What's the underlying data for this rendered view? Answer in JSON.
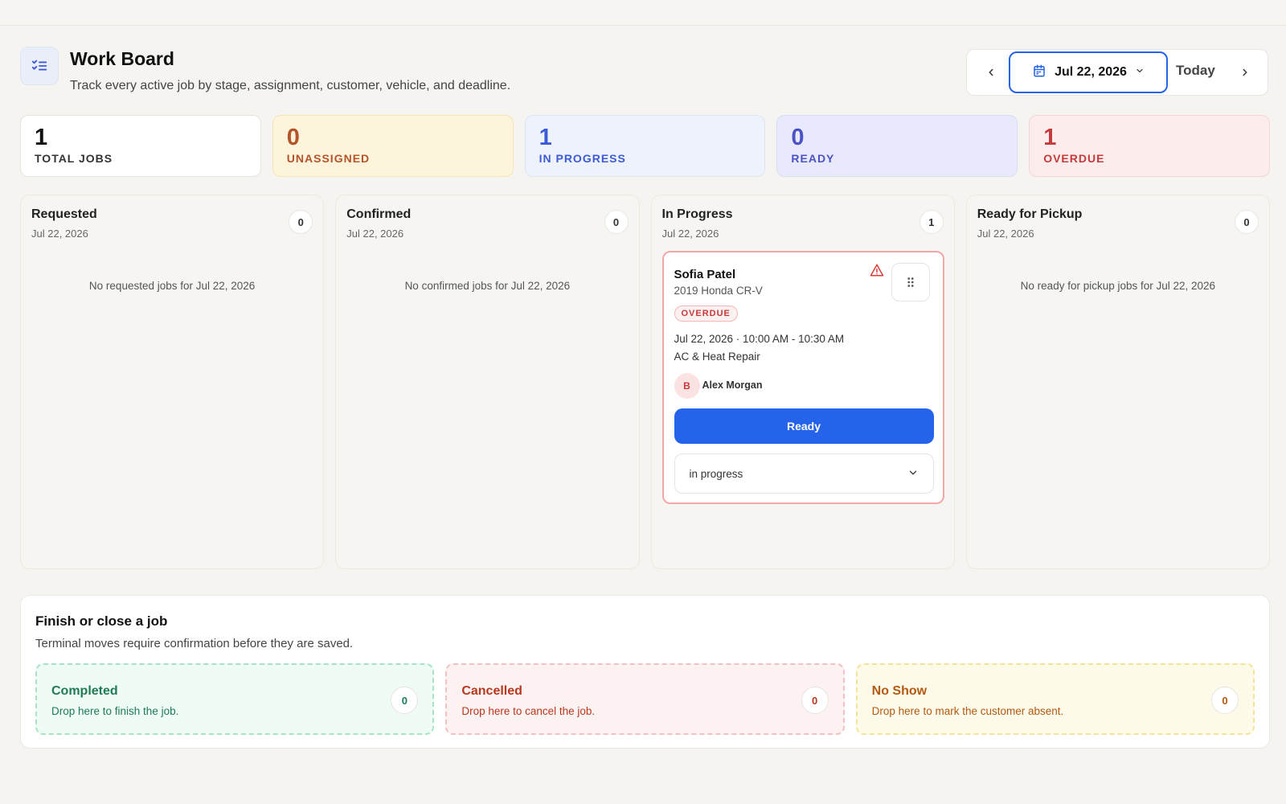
{
  "header": {
    "title": "Work Board",
    "subtitle": "Track every active job by stage, assignment, customer, vehicle, and deadline."
  },
  "datebar": {
    "date_label": "Jul 22, 2026",
    "today_label": "Today"
  },
  "stats": [
    {
      "value": "1",
      "label": "TOTAL JOBS"
    },
    {
      "value": "0",
      "label": "UNASSIGNED"
    },
    {
      "value": "1",
      "label": "IN PROGRESS"
    },
    {
      "value": "0",
      "label": "READY"
    },
    {
      "value": "1",
      "label": "OVERDUE"
    }
  ],
  "columns": [
    {
      "title": "Requested",
      "date": "Jul 22, 2026",
      "count": "0",
      "empty": "No requested jobs for Jul 22, 2026"
    },
    {
      "title": "Confirmed",
      "date": "Jul 22, 2026",
      "count": "0",
      "empty": "No confirmed jobs for Jul 22, 2026"
    },
    {
      "title": "In Progress",
      "date": "Jul 22, 2026",
      "count": "1",
      "empty": ""
    },
    {
      "title": "Ready for Pickup",
      "date": "Jul 22, 2026",
      "count": "0",
      "empty": "No ready for pickup jobs for Jul 22, 2026"
    }
  ],
  "job": {
    "customer": "Sofia Patel",
    "vehicle": "2019 Honda CR-V",
    "badge": "OVERDUE",
    "schedule": "Jul 22, 2026 · 10:00 AM - 10:30 AM",
    "service": "AC & Heat Repair",
    "avatar_initial": "B",
    "technician": "Alex Morgan",
    "action_label": "Ready",
    "status_value": "in progress"
  },
  "terminal": {
    "title": "Finish or close a job",
    "subtitle": "Terminal moves require confirmation before they are saved.",
    "drops": [
      {
        "title": "Completed",
        "desc": "Drop here to finish the job.",
        "count": "0"
      },
      {
        "title": "Cancelled",
        "desc": "Drop here to cancel the job.",
        "count": "0"
      },
      {
        "title": "No Show",
        "desc": "Drop here to mark the customer absent.",
        "count": "0"
      }
    ]
  },
  "colors": {
    "accent": "#2563eb",
    "overdue": "#c53a3a",
    "warning": "#b5542a",
    "success": "#1f7a55"
  },
  "icons": {
    "header": "checklist-icon",
    "prev": "chevron-left-icon",
    "next": "chevron-right-icon",
    "calendar": "calendar-icon",
    "dropdown": "chevron-down-icon",
    "alert": "alert-triangle-icon",
    "drag": "drag-handle-icon"
  }
}
